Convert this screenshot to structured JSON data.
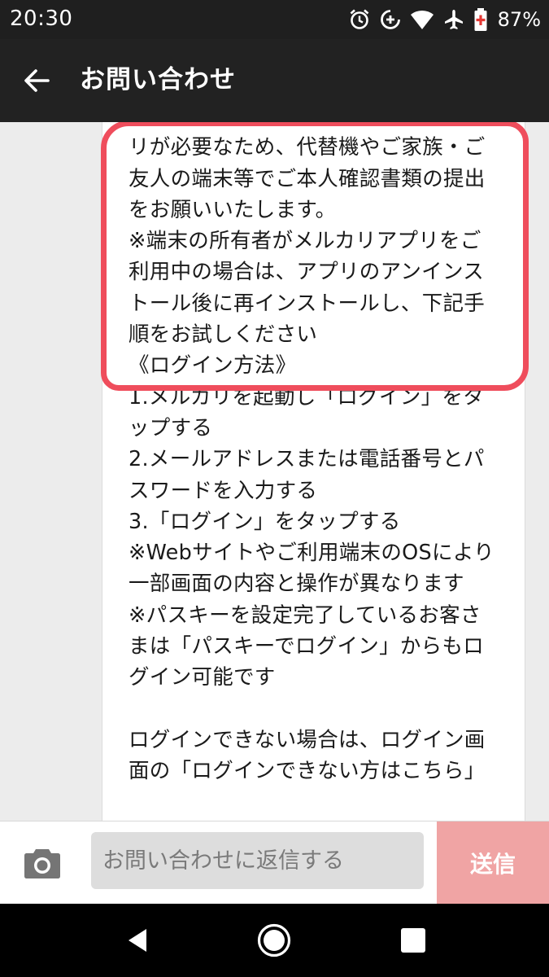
{
  "status_bar": {
    "time": "20:30",
    "battery_percent": "87%",
    "icons": [
      "alarm-icon",
      "data-saver-icon",
      "wifi-icon",
      "airplane-icon",
      "battery-icon"
    ]
  },
  "app_bar": {
    "title": "お問い合わせ",
    "back_icon": "arrow-back-icon"
  },
  "message": {
    "highlighted_text": "恐れ入りますが、ご本人確認にはアプ\nリが必要なため、代替機やご家族・ご\n友人の端末等でご本人確認書類の提出\nをお願いいたします。\n※端末の所有者がメルカリアプリをご\n利用中の場合は、アプリのアンインス\nトール後に再インストールし、下記手\n順をお試しください",
    "body_text": "\n《ログイン方法》\n1.メルカリを起動し「ログイン」をタ\nップする\n2.メールアドレスまたは電話番号とパ\nスワードを入力する\n3.「ログイン」をタップする\n※Webサイトやご利用端末のOSにより\n一部画面の内容と操作が異なります\n※パスキーを設定完了しているお客さ\nまは「パスキーでログイン」からもロ\nグイン可能です\n\nログインできない場合は、ログイン画\n面の「ログインできない方はこちら」",
    "highlight_color": "#ef4d5c"
  },
  "input_bar": {
    "camera_icon": "camera-icon",
    "placeholder": "お問い合わせに返信する",
    "send_label": "送信",
    "send_color": "#f0a4a4"
  },
  "nav_bar": {
    "icons": [
      "back-triangle-icon",
      "home-circle-icon",
      "recents-square-icon"
    ]
  }
}
